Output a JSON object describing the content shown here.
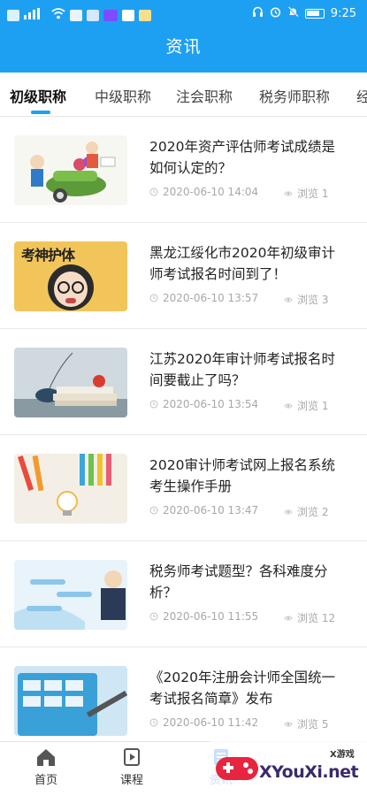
{
  "status_bar": {
    "time": "9:25",
    "left_chips": [
      "HD",
      "4G",
      "≡",
      "wifi",
      "blue-app",
      "pink-app",
      "nfc",
      "green-app"
    ]
  },
  "header": {
    "title": "资讯",
    "background_color": "#1ea0f2"
  },
  "tabs": [
    {
      "label": "初级职称",
      "active": true
    },
    {
      "label": "中级职称",
      "active": false
    },
    {
      "label": "注会职称",
      "active": false
    },
    {
      "label": "税务师职称",
      "active": false
    },
    {
      "label": "经",
      "active": false
    }
  ],
  "news": [
    {
      "title": "2020年资产评估师考试成绩是如何认定的？",
      "time": "2020-06-10 14:04",
      "views": "浏览 1",
      "image": "cartoon-wheelbarrow-money"
    },
    {
      "title": "黑龙江绥化市2020年初级审计师考试报名时间到了！",
      "time": "2020-06-10 13:57",
      "views": "浏览 3",
      "image": "cartoon-girl-exam",
      "image_text": "考神护体"
    },
    {
      "title": "江苏2020年审计师考试报名时间要截止了吗？",
      "time": "2020-06-10 13:54",
      "views": "浏览 1",
      "image": "books-and-vase"
    },
    {
      "title": "2020审计师考试网上报名系统考生操作手册",
      "time": "2020-06-10 13:47",
      "views": "浏览 2",
      "image": "pencils-lightbulb"
    },
    {
      "title": "税务师考试题型？各科难度分析？",
      "time": "2020-06-10 11:55",
      "views": "浏览 12",
      "image": "teacher-presentation"
    },
    {
      "title": "《2020年注册会计师全国统一考试报名简章》发布",
      "time": "2020-06-10 11:42",
      "views": "浏览 5",
      "image": "calculator-pen"
    }
  ],
  "bottom_nav": [
    {
      "label": "首页",
      "icon": "home-icon"
    },
    {
      "label": "课程",
      "icon": "course-icon"
    },
    {
      "label": "资讯",
      "icon": "news-icon"
    }
  ],
  "watermark": {
    "text": "XYouXi.net",
    "sub": "X游戏"
  }
}
